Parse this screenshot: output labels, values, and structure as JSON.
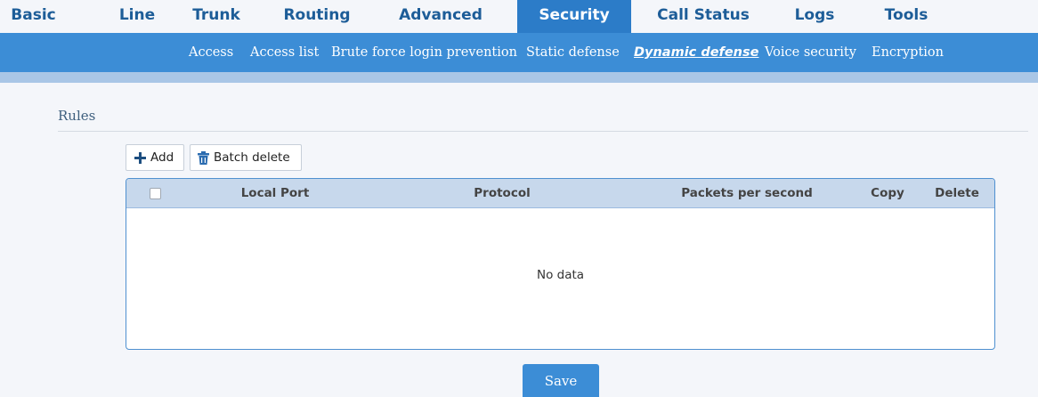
{
  "topnav": [
    {
      "label": "Basic"
    },
    {
      "label": "Line"
    },
    {
      "label": "Trunk"
    },
    {
      "label": "Routing"
    },
    {
      "label": "Advanced"
    },
    {
      "label": "Security"
    },
    {
      "label": "Call Status"
    },
    {
      "label": "Logs"
    },
    {
      "label": "Tools"
    }
  ],
  "subnav": [
    {
      "label": "Access"
    },
    {
      "label": "Access list"
    },
    {
      "label": "Brute force login prevention"
    },
    {
      "label": "Static defense"
    },
    {
      "label": "Dynamic defense"
    },
    {
      "label": "Voice security"
    },
    {
      "label": "Encryption"
    }
  ],
  "active_top": "Security",
  "active_sub": "Dynamic defense",
  "section": {
    "title": "Rules"
  },
  "toolbar": {
    "add_label": "Add",
    "batch_delete_label": "Batch delete"
  },
  "table": {
    "columns": [
      "Local Port",
      "Protocol",
      "Packets per second",
      "Copy",
      "Delete"
    ],
    "empty_text": "No data"
  },
  "save_label": "Save",
  "colors": {
    "nav_active": "#2c7cc8",
    "subnav_bg": "#3c8dd6",
    "nav_text": "#1d5d98"
  }
}
